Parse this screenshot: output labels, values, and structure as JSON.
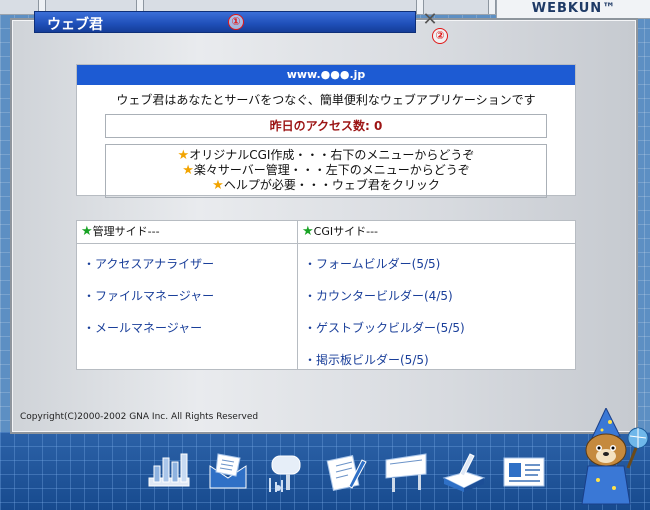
{
  "brand": "WEBKUN™",
  "window": {
    "title": "ウェブ君",
    "badge1": "①",
    "badge2": "②",
    "close": "✕"
  },
  "info": {
    "header": "www.●●●.jp",
    "intro": "ウェブ君はあなたとサーバをつなぐ、簡単便利なウェブアプリケーションです",
    "access_label": "昨日のアクセス数: 0",
    "lines": [
      "オリジナルCGI作成・・・右下のメニューからどうぞ",
      "楽々サーバー管理・・・左下のメニューからどうぞ",
      "ヘルプが必要・・・ウェブ君をクリック"
    ]
  },
  "menu": {
    "left_header": "管理サイド---",
    "right_header": "CGIサイド---",
    "left_items": [
      "・アクセスアナライザー",
      "・ファイルマネージャー",
      "・メールマネージャー"
    ],
    "right_items": [
      "・フォームビルダー(5/5)",
      "・カウンタービルダー(4/5)",
      "・ゲストブックビルダー(5/5)",
      "・掲示板ビルダー(5/5)"
    ]
  },
  "copyright": "Copyright(C)2000-2002 GNA Inc. All Rights Reserved",
  "toolbar": [
    "chart-icon",
    "mail-icon",
    "mailbox-icon",
    "pencil-icon",
    "board-icon",
    "book-icon",
    "card-icon"
  ],
  "colors": {
    "accent": "#1d5bd3",
    "title_bar": "#1f4fb8",
    "access_text": "#9c1414",
    "star": "#f2a400",
    "star_green": "#19a325"
  }
}
